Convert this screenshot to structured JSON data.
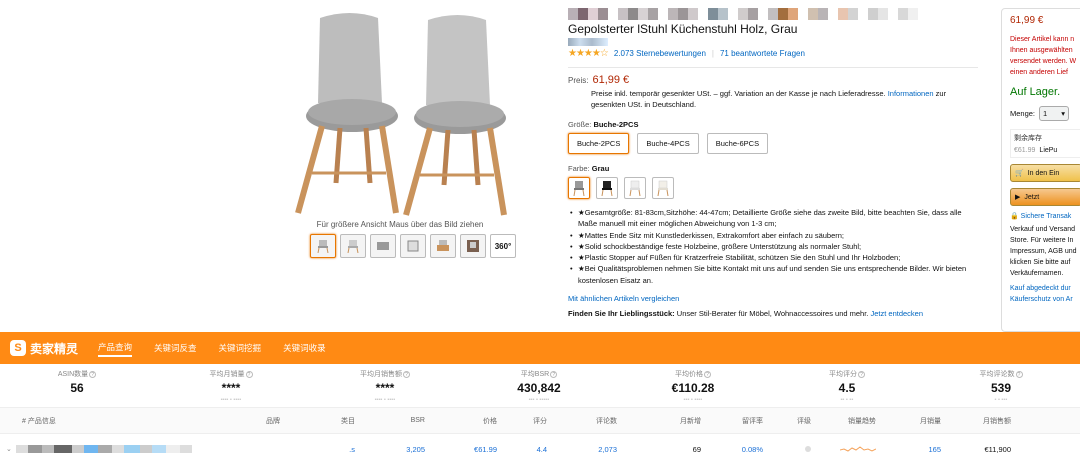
{
  "gallery": {
    "hover_hint": "Für größere Ansicht Maus über das Bild ziehen",
    "thumb_360_label": "360°"
  },
  "product": {
    "title": "Gepolsterter lStuhl Küchenstuhl Holz, Grau",
    "stars_glyph": "★★★★☆",
    "ratings_count": "2.073 Sternebewertungen",
    "rating_separator": "|",
    "answered_questions": "71 beantwortete Fragen",
    "price_label": "Preis:",
    "price_value": "61,99 €",
    "price_note_prefix": "Preise inkl. temporär gesenkter USt. – ggf. Variation an der Kasse je nach Lieferadresse.",
    "price_note_link": "Informationen",
    "price_note_suffix": "zur gesenkten USt. in Deutschland.",
    "size_label": "Größe:",
    "size_selected": "Buche-2PCS",
    "size_options": [
      "Buche-2PCS",
      "Buche-4PCS",
      "Buche-6PCS"
    ],
    "color_label": "Farbe:",
    "color_selected": "Grau",
    "bullets": [
      "★Gesamtgröße: 81-83cm,Sitzhöhe: 44-47cm; Detaillierte Größe siehe das zweite Bild, bitte beachten Sie, dass alle Maße manuell mit einer möglichen Abweichung von 1-3 cm;",
      "★Mattes Ende Sitz mit Kunstlederkissen, Extrakomfort aber einfach zu säubern;",
      "★Solid schockbeständige feste Holzbeine, größere Unterstützung als normaler Stuhl;",
      "★Plastic Stopper auf Füßen für Kratzerfreie Stabilität, schützen Sie den Stuhl und Ihr Holzboden;",
      "★Bei Qualitätsproblemen nehmen Sie bitte Kontakt mit uns auf und senden Sie uns entsprechende Bilder. Wir bieten kostenlosen Eisatz an."
    ],
    "compare_link": "Mit ähnlichen Artikeln vergleichen",
    "find_fav_bold": "Finden Sie Ihr Lieblingsstück:",
    "find_fav_text": "Unser Stil-Berater für Möbel, Wohnaccessoires und mehr.",
    "find_fav_link": "Jetzt entdecken"
  },
  "buybox": {
    "price": "61,99 €",
    "warn_lines": [
      "Dieser Artikel kann n",
      "Ihnen ausgewählten",
      "versendet werden. W",
      "einen anderen Lief"
    ],
    "stock": "Auf Lager.",
    "qty_label": "Menge:",
    "qty_value": "1",
    "widget_title": "剩余库存",
    "widget_price": "€61.99",
    "widget_seller": "LiePu",
    "cart_label": "In den Ein",
    "buy_label": "Jetzt",
    "secure_label": "Sichere Transak",
    "info_lines": [
      "Verkauf und Versand",
      "Store. Für weitere In",
      "Impressum, AGB und",
      "klicken Sie bitte auf",
      "Verkäufernamen."
    ],
    "foot_lines": [
      "Kauf abgedeckt dur",
      "Käuferschutz von Ar"
    ]
  },
  "plugin": {
    "logo_text": "卖家精灵",
    "tabs": [
      "产品查询",
      "关键词反查",
      "关键词挖掘",
      "关键词收录"
    ],
    "metrics": [
      {
        "label": "ASIN数量",
        "value": "56"
      },
      {
        "label": "平均月销量",
        "value": "****"
      },
      {
        "label": "平均月销售额",
        "value": "****"
      },
      {
        "label": "平均BSR",
        "value": "430,842"
      },
      {
        "label": "平均价格",
        "value": "€110.28"
      },
      {
        "label": "平均评分",
        "value": "4.5"
      },
      {
        "label": "平均评论数",
        "value": "539"
      }
    ],
    "columns": [
      "# 产品信息",
      "品牌",
      "类目",
      "BSR",
      "价格",
      "评分",
      "评论数",
      "月新增",
      "留评率",
      "评级",
      "销量趋势",
      "月销量",
      "月销售额"
    ],
    "row": {
      "category": ".s",
      "bsr": "3,205",
      "price": "€61.99",
      "rating": "4.4",
      "reviews": "2,073",
      "monthly_new": "69",
      "review_rate": "0.08%",
      "monthly_sales": "165",
      "monthly_revenue": "€11,900"
    }
  },
  "colors": {
    "accent": "#ff8a14",
    "price_red": "#b12704",
    "link_blue": "#0066c0",
    "stock_green": "#007600"
  }
}
